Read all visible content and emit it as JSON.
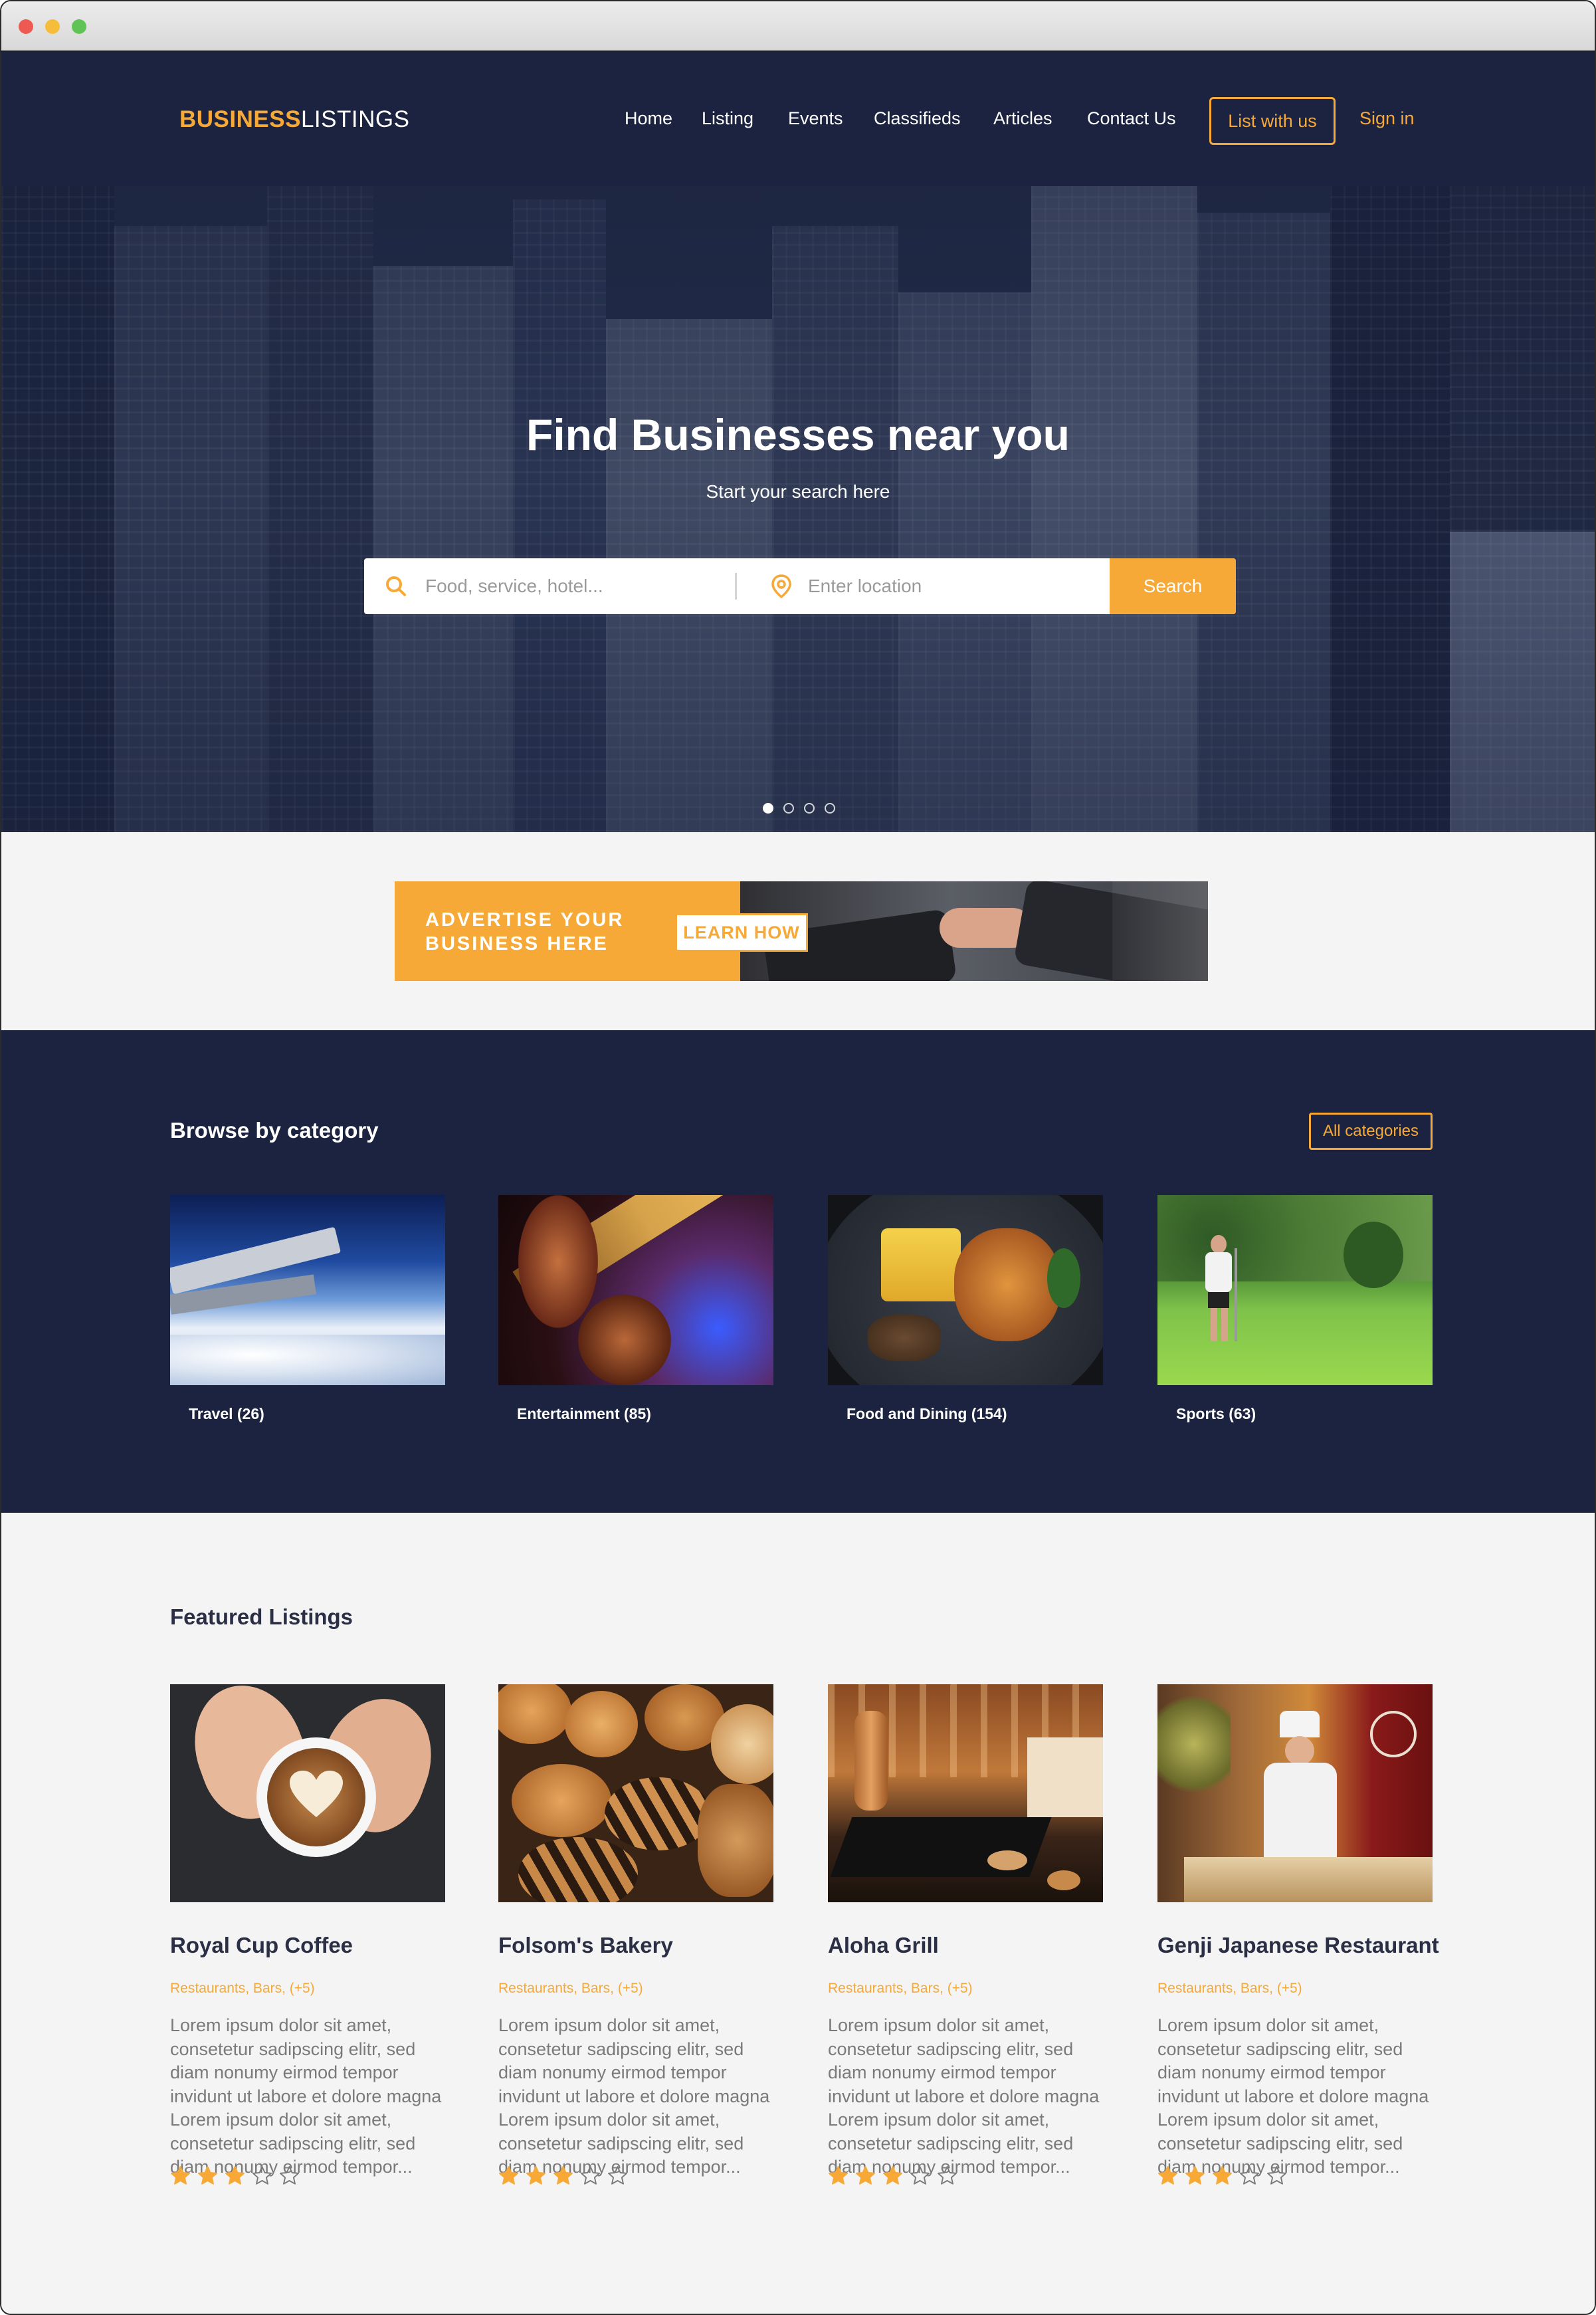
{
  "colors": {
    "navy": "#1b2340",
    "accent": "#f7a937",
    "background": "#f4f4f4"
  },
  "brand": {
    "part1": "BUSINESS",
    "part2": "LISTINGS"
  },
  "nav": {
    "links": [
      "Home",
      "Listing",
      "Events",
      "Classifieds",
      "Articles",
      "Contact Us"
    ],
    "list_button": "List with us",
    "signin": "Sign in"
  },
  "hero": {
    "title": "Find Businesses near you",
    "subtitle": "Start your search here",
    "search_placeholder": "Food, service, hotel...",
    "location_placeholder": "Enter location",
    "search_button": "Search",
    "search_icon": "search-icon",
    "location_icon": "map-pin-icon",
    "slides": 4,
    "active_slide": 1
  },
  "ad": {
    "line1": "ADVERTISE YOUR",
    "line2": "BUSINESS HERE",
    "button": "LEARN HOW"
  },
  "categories": {
    "title": "Browse by category",
    "all_button": "All categories",
    "items": [
      {
        "label": "Travel (26)",
        "image": "airplane-wing-photo"
      },
      {
        "label": "Entertainment (85)",
        "image": "guitar-photo"
      },
      {
        "label": "Food and Dining (154)",
        "image": "roast-dish-photo"
      },
      {
        "label": "Sports (63)",
        "image": "golf-course-photo"
      }
    ]
  },
  "featured": {
    "title": "Featured Listings",
    "items": [
      {
        "name": "Royal Cup Coffee",
        "cats": "Restaurants, Bars, (+5)",
        "desc": "Lorem ipsum dolor sit amet, consetetur sadipscing elitr, sed diam nonumy eirmod tempor invidunt ut labore et dolore magna Lorem ipsum dolor sit amet, consetetur sadipscing elitr, sed diam nonumy eirmod tempor...",
        "rating": 3,
        "image": "latte-photo"
      },
      {
        "name": "Folsom's Bakery",
        "cats": "Restaurants, Bars, (+5)",
        "desc": "Lorem ipsum dolor sit amet, consetetur sadipscing elitr, sed diam nonumy eirmod tempor invidunt ut labore et dolore magna Lorem ipsum dolor sit amet, consetetur sadipscing elitr, sed diam nonumy eirmod tempor...",
        "rating": 3,
        "image": "pastries-photo"
      },
      {
        "name": "Aloha Grill",
        "cats": "Restaurants, Bars, (+5)",
        "desc": "Lorem ipsum dolor sit amet, consetetur sadipscing elitr, sed diam nonumy eirmod tempor invidunt ut labore et dolore magna Lorem ipsum dolor sit amet, consetetur sadipscing elitr, sed diam nonumy eirmod tempor...",
        "rating": 3,
        "image": "restaurant-interior-photo"
      },
      {
        "name": "Genji Japanese Restaurant",
        "cats": "Restaurants, Bars, (+5)",
        "desc": "Lorem ipsum dolor sit amet, consetetur sadipscing elitr, sed diam nonumy eirmod tempor invidunt ut labore et dolore magna Lorem ipsum dolor sit amet, consetetur sadipscing elitr, sed diam nonumy eirmod tempor...",
        "rating": 3,
        "image": "chef-photo"
      }
    ],
    "max_rating": 5
  }
}
